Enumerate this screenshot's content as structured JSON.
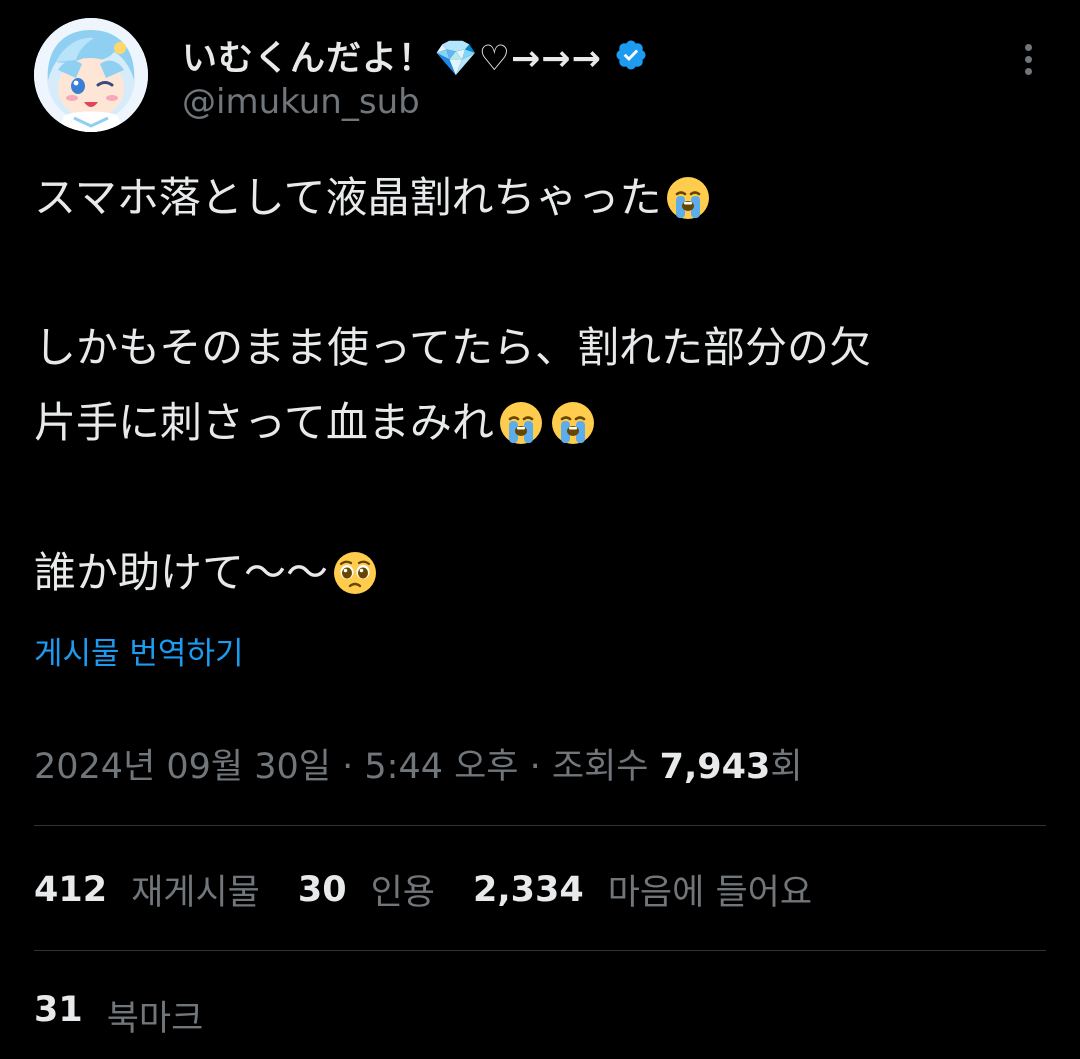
{
  "author": {
    "display_name": "いむくんだよ！💎♡→→→",
    "handle": "@imukun_sub",
    "verified_icon": "verified-badge-icon",
    "avatar_icon": "anime-avatar",
    "verified_color": "#1d9bf0"
  },
  "more_icon": "more-vertical-icon",
  "tweet": {
    "lines": [
      {
        "text": "スマホ落として液晶割れちゃった",
        "emojis": [
          "crying-face-emoji"
        ]
      },
      {
        "text": "",
        "emojis": []
      },
      {
        "text": "しかもそのまま使ってたら、割れた部分の欠",
        "emojis": []
      },
      {
        "text": "片手に刺さって血まみれ",
        "emojis": [
          "crying-face-emoji",
          "crying-face-emoji"
        ]
      },
      {
        "text": "",
        "emojis": []
      },
      {
        "text": "誰か助けて〜〜",
        "emojis": [
          "pleading-face-emoji"
        ]
      }
    ]
  },
  "translate_label": "게시물 번역하기",
  "meta": {
    "date": "2024년 09월 30일",
    "separator": " · ",
    "time": "5:44 오후",
    "views_label": "조회수",
    "views_count": "7,943",
    "views_suffix": "회"
  },
  "stats": [
    {
      "count": "412",
      "label": "재게시물"
    },
    {
      "count": "30",
      "label": "인용"
    },
    {
      "count": "2,334",
      "label": "마음에 들어요"
    }
  ],
  "bookmarks": {
    "count": "31",
    "label": "북마크"
  },
  "colors": {
    "background": "#000000",
    "text": "#e7e9ea",
    "muted": "#71767b",
    "link": "#1d9bf0",
    "divider": "#2f3336"
  }
}
